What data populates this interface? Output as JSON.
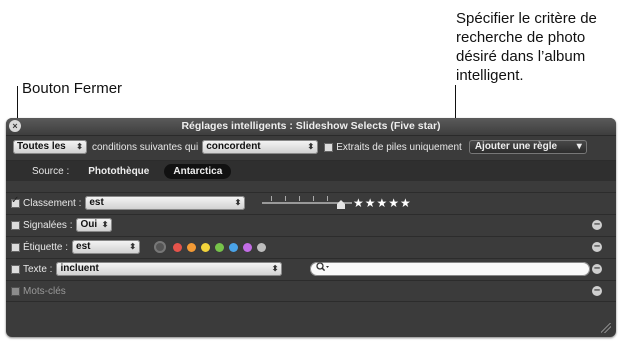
{
  "callouts": {
    "close_button": "Bouton Fermer",
    "criteria_lines": [
      "Spécifier le critère de",
      "recherche de photo",
      "désiré dans l’album",
      "intelligent."
    ]
  },
  "window": {
    "title": "Réglages intelligents : Slideshow Selects (Five star)",
    "close_symbol": "×"
  },
  "conditions_row": {
    "match_select": "Toutes les",
    "middle_text": "conditions suivantes qui",
    "match_type_select": "concordent",
    "stacks_checkbox_label": "Extraits de piles uniquement",
    "stacks_checked": false,
    "add_rule_button": "Ajouter une règle"
  },
  "source_row": {
    "label": "Source :",
    "tabs": [
      {
        "label": "Photothèque",
        "active": false
      },
      {
        "label": "Antarctica",
        "active": true
      }
    ]
  },
  "rules": [
    {
      "checkbox_label": "Classement :",
      "checked": true,
      "operator": "est",
      "rating": "★★★★★",
      "rating_value": 5
    },
    {
      "checkbox_label": "Signalées :",
      "checked": false,
      "operator": "Oui"
    },
    {
      "checkbox_label": "Étiquette :",
      "checked": false,
      "operator": "est",
      "color_labels": [
        "#e5534b",
        "#f39a35",
        "#f2d33b",
        "#77c34a",
        "#4aa3e8",
        "#c36de6",
        "#bdbdbd"
      ]
    },
    {
      "checkbox_label": "Texte :",
      "checked": false,
      "operator": "incluent",
      "search_value": "",
      "search_icon": "magnifier-icon"
    },
    {
      "checkbox_label": "Mots-clés",
      "checked": false,
      "disabled": true
    }
  ],
  "remove_symbol": "–",
  "popup_arrow": "⬍",
  "pulldown_arrow": "▾"
}
